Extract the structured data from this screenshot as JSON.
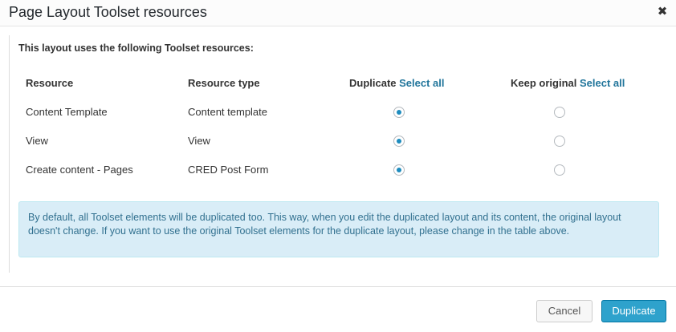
{
  "dialog": {
    "title": "Page Layout Toolset resources",
    "close_glyph": "✖"
  },
  "intro": "This layout uses the following Toolset resources:",
  "table": {
    "headers": {
      "resource": "Resource",
      "resource_type": "Resource type",
      "duplicate": "Duplicate",
      "keep_original": "Keep original",
      "select_all": "Select all"
    },
    "rows": [
      {
        "resource": "Content Template",
        "type": "Content template",
        "selected": "duplicate"
      },
      {
        "resource": "View",
        "type": "View",
        "selected": "duplicate"
      },
      {
        "resource": "Create content - Pages",
        "type": "CRED Post Form",
        "selected": "duplicate"
      }
    ]
  },
  "notice": "By default, all Toolset elements will be duplicated too. This way, when you edit the duplicated layout and its content, the original layout doesn't change. If you want to use the original Toolset elements for the duplicate layout, please change in the table above.",
  "footer": {
    "cancel_label": "Cancel",
    "primary_label": "Duplicate"
  },
  "colors": {
    "accent": "#1e8cbe",
    "primary_button": "#2ea2cc",
    "notice_bg": "#d9edf7",
    "link": "#21759b"
  }
}
